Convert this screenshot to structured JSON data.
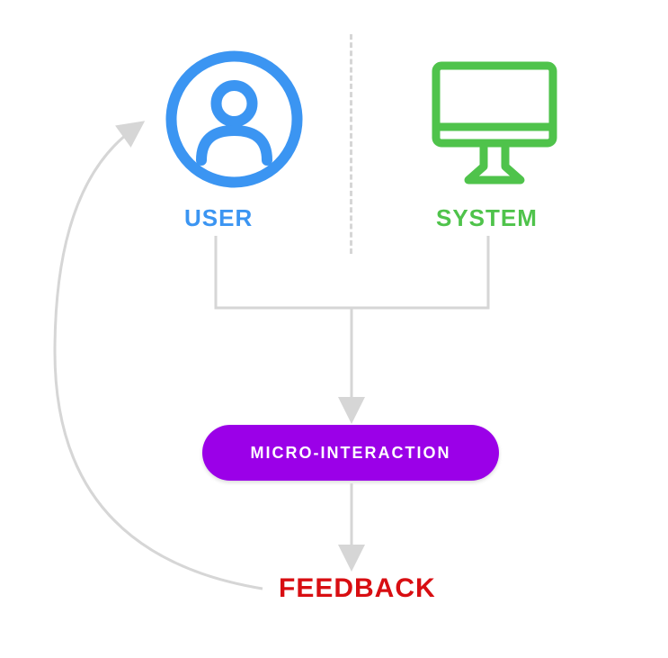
{
  "labels": {
    "user": "USER",
    "system": "SYSTEM",
    "microInteraction": "MICRO-INTERACTION",
    "feedback": "FEEDBACK"
  },
  "colors": {
    "user": "#3b95f2",
    "system": "#4fc34b",
    "microInteraction": "#9b00e8",
    "feedback": "#d80e12",
    "connector": "#d6d6d6",
    "divider": "#d6d6d6"
  },
  "diagram": {
    "nodes": [
      {
        "id": "user",
        "type": "actor",
        "label": "USER"
      },
      {
        "id": "system",
        "type": "system",
        "label": "SYSTEM"
      },
      {
        "id": "micro-interaction",
        "type": "process",
        "label": "MICRO-INTERACTION"
      },
      {
        "id": "feedback",
        "type": "output",
        "label": "FEEDBACK"
      }
    ],
    "edges": [
      {
        "from": "user",
        "to": "micro-interaction"
      },
      {
        "from": "system",
        "to": "micro-interaction"
      },
      {
        "from": "micro-interaction",
        "to": "feedback"
      },
      {
        "from": "feedback",
        "to": "user",
        "type": "loop"
      }
    ]
  }
}
